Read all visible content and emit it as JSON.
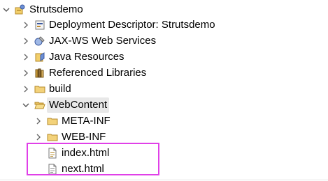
{
  "tree": {
    "project": {
      "label": "Strutsdemo",
      "icon": "project-icon",
      "expanded": true
    },
    "children": [
      {
        "label": "Deployment Descriptor: Strutsdemo",
        "icon": "deployment-descriptor-icon",
        "expanded": false
      },
      {
        "label": "JAX-WS Web Services",
        "icon": "web-services-icon",
        "expanded": false
      },
      {
        "label": "Java Resources",
        "icon": "java-resources-icon",
        "expanded": false
      },
      {
        "label": "Referenced Libraries",
        "icon": "library-icon",
        "expanded": false
      },
      {
        "label": "build",
        "icon": "folder-icon",
        "expanded": false
      },
      {
        "label": "WebContent",
        "icon": "open-folder-icon",
        "expanded": true,
        "selected": true
      }
    ],
    "webcontent_children": [
      {
        "label": "META-INF",
        "icon": "folder-icon",
        "expanded": false
      },
      {
        "label": "WEB-INF",
        "icon": "folder-icon",
        "expanded": false
      },
      {
        "label": "index.html",
        "icon": "html-file-icon"
      },
      {
        "label": "next.html",
        "icon": "html-file-icon"
      }
    ]
  },
  "colors": {
    "highlight_border": "#e040e8",
    "selection_background": "#e8e8e8",
    "folder_yellow": "#f0c050"
  }
}
